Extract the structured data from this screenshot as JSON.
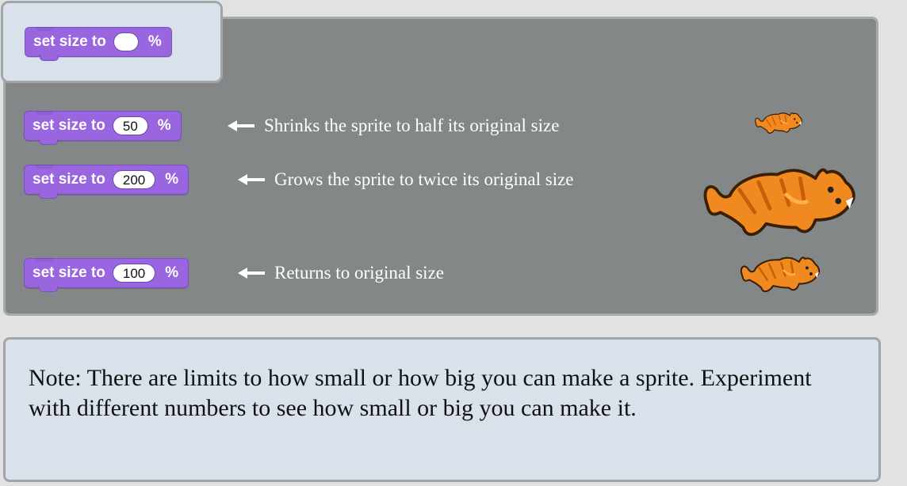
{
  "header_block": {
    "label": "set size to",
    "unit": "%",
    "value": ""
  },
  "examples": [
    {
      "label": "set size to",
      "value": "50",
      "unit": "%",
      "description": "Shrinks the sprite to half its original size",
      "sprite_scale": 0.5
    },
    {
      "label": "set size to",
      "value": "200",
      "unit": "%",
      "description": "Grows the sprite to twice its original size",
      "sprite_scale": 2.0
    },
    {
      "label": "set size to",
      "value": "100",
      "unit": "%",
      "description": "Returns to original size",
      "sprite_scale": 1.0
    }
  ],
  "note": "Note: There are limits to how small or how big you can make a sprite. Experiment with different numbers to see how small or big you can make it.",
  "colors": {
    "block": "#9966e0",
    "panel": "#838788",
    "card": "#d9e1ea",
    "sprite": "#f08a20"
  },
  "icons": [
    "left-arrow-icon",
    "cat-sprite-icon"
  ]
}
